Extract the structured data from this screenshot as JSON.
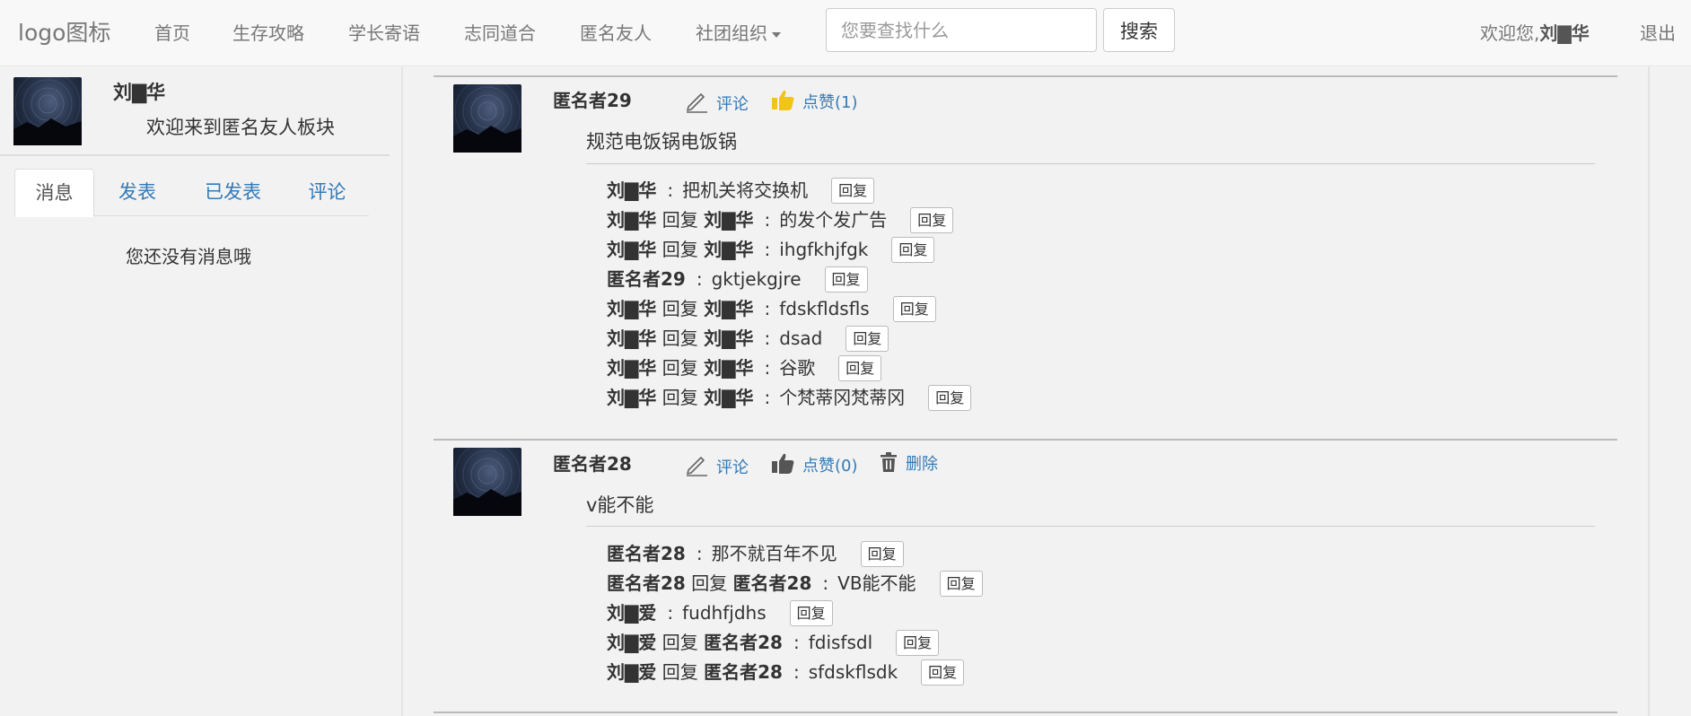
{
  "nav": {
    "brand": "logo图标",
    "items": [
      "首页",
      "生存攻略",
      "学长寄语",
      "志同道合",
      "匿名友人",
      "社团组织"
    ],
    "search_placeholder": "您要查找什么",
    "search_button": "搜索",
    "welcome_prefix": "欢迎您,",
    "username": "刘▇华",
    "logout": "退出"
  },
  "sidebar": {
    "name": "刘▇华",
    "welcome": "欢迎来到匿名友人板块",
    "tabs": [
      "消息",
      "发表",
      "已发表",
      "评论"
    ],
    "active_tab": "消息",
    "empty_message": "您还没有消息哦"
  },
  "posts": [
    {
      "author": "匿名者29",
      "comment_label": "评论",
      "like_label": "点赞(1)",
      "content": "规范电饭锅电饭锅",
      "comments": [
        {
          "from": "刘▇华",
          "reply": "",
          "to": "",
          "text": "把机关将交换机",
          "button": "回复"
        },
        {
          "from": "刘▇华",
          "reply": "回复",
          "to": "刘▇华",
          "text": "的发个发广告",
          "button": "回复"
        },
        {
          "from": "刘▇华",
          "reply": "回复",
          "to": "刘▇华",
          "text": "ihgfkhjfgk",
          "button": "回复"
        },
        {
          "from": "匿名者29",
          "reply": "",
          "to": "",
          "text": "gktjekgjre",
          "button": "回复"
        },
        {
          "from": "刘▇华",
          "reply": "回复",
          "to": "刘▇华",
          "text": "fdskfldsfls",
          "button": "回复"
        },
        {
          "from": "刘▇华",
          "reply": "回复",
          "to": "刘▇华",
          "text": "dsad",
          "button": "回复"
        },
        {
          "from": "刘▇华",
          "reply": "回复",
          "to": "刘▇华",
          "text": "谷歌",
          "button": "回复"
        },
        {
          "from": "刘▇华",
          "reply": "回复",
          "to": "刘▇华",
          "text": "个梵蒂冈梵蒂冈",
          "button": "回复"
        }
      ]
    },
    {
      "author": "匿名者28",
      "comment_label": "评论",
      "like_label": "点赞(0)",
      "delete_label": "删除",
      "content": "v能不能",
      "comments": [
        {
          "from": "匿名者28",
          "reply": "",
          "to": "",
          "text": "那不就百年不见",
          "button": "回复"
        },
        {
          "from": "匿名者28",
          "reply": "回复",
          "to": "匿名者28",
          "text": "VB能不能",
          "button": "回复"
        },
        {
          "from": "刘▇爱",
          "reply": "",
          "to": "",
          "text": "fudhfjdhs",
          "button": "回复"
        },
        {
          "from": "刘▇爱",
          "reply": "回复",
          "to": "匿名者28",
          "text": "fdisfsdl",
          "button": "回复"
        },
        {
          "from": "刘▇爱",
          "reply": "回复",
          "to": "匿名者28",
          "text": "sfdskflsdk",
          "button": "回复"
        }
      ]
    }
  ],
  "colors": {
    "link": "#337ab7",
    "like_active": "#f0c419",
    "like_inactive": "#555555",
    "background": "#f2f2f2"
  }
}
